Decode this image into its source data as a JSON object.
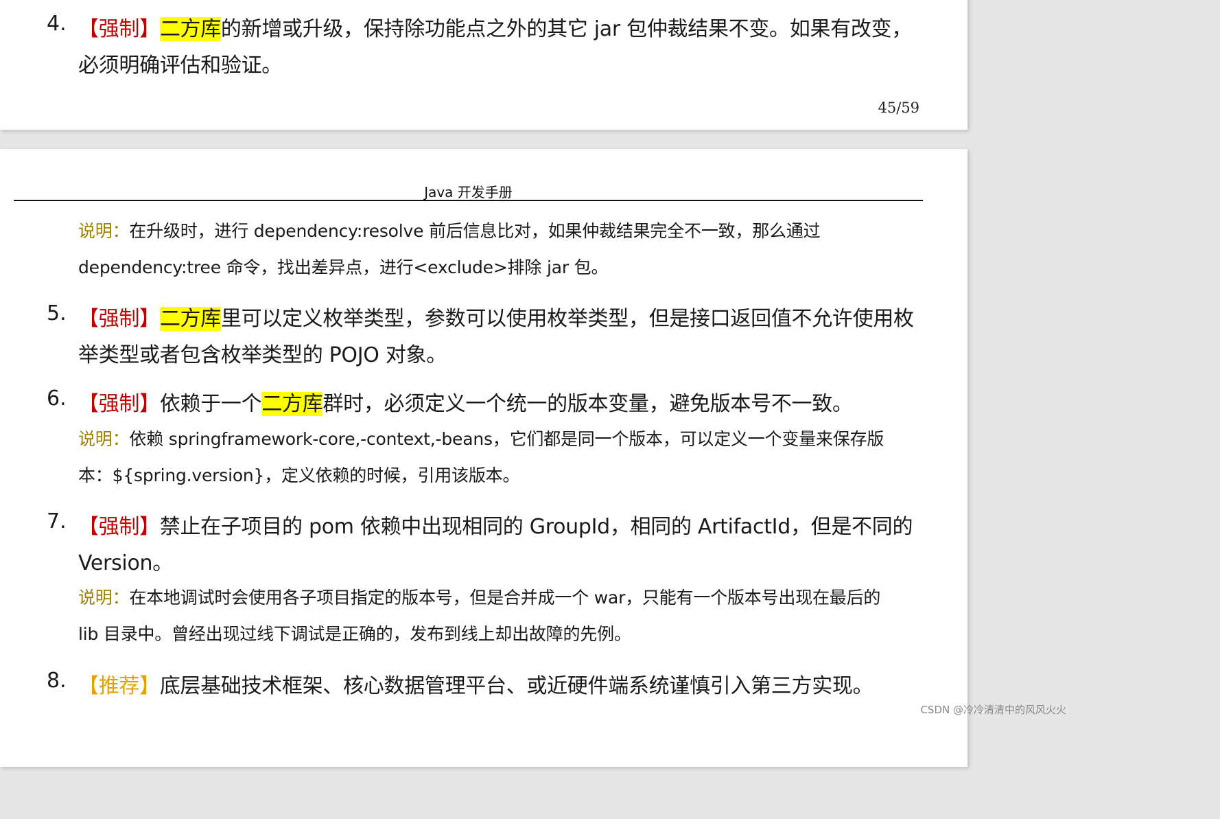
{
  "page1": {
    "item4": {
      "number": "4.",
      "tag": "【强制】",
      "highlight": "二方库",
      "line1_rest": "的新增或升级，保持除功能点之外的其它 jar 包仲裁结果不变。如果有改变，",
      "line2": "必须明确评估和验证。"
    },
    "page_number": "45/59"
  },
  "page2": {
    "header_title": "Java 开发手册",
    "note4": {
      "label": "说明：",
      "line1_rest": "在升级时，进行 dependency:resolve 前后信息比对，如果仲裁结果完全不一致，那么通过",
      "line2": "dependency:tree 命令，找出差异点，进行<exclude>排除 jar 包。"
    },
    "item5": {
      "number": "5.",
      "tag": "【强制】",
      "highlight": "二方库",
      "line1_rest": "里可以定义枚举类型，参数可以使用枚举类型，但是接口返回值不允许使用枚",
      "line2": "举类型或者包含枚举类型的 POJO 对象。"
    },
    "item6": {
      "number": "6.",
      "tag": "【强制】",
      "line1_pre": "依赖于一个",
      "highlight": "二方库",
      "line1_post": "群时，必须定义一个统一的版本变量，避免版本号不一致。",
      "note_label": "说明：",
      "note_line1_rest": "依赖 springframework-core,-context,-beans，它们都是同一个版本，可以定义一个变量来保存版",
      "note_line2": "本：${spring.version}，定义依赖的时候，引用该版本。"
    },
    "item7": {
      "number": "7.",
      "tag": "【强制】",
      "line1_rest": "禁止在子项目的 pom 依赖中出现相同的 GroupId，相同的 ArtifactId，但是不同的",
      "line2": "Version。",
      "note_label": "说明：",
      "note_line1_rest": "在本地调试时会使用各子项目指定的版本号，但是合并成一个 war，只能有一个版本号出现在最后的",
      "note_line2": "lib 目录中。曾经出现过线下调试是正确的，发布到线上却出故障的先例。"
    },
    "item8": {
      "number": "8.",
      "tag": "【推荐】",
      "line1_rest": "底层基础技术框架、核心数据管理平台、或近硬件端系统谨慎引入第三方实现。"
    }
  },
  "watermark": "CSDN @冷冷清清中的风风火火"
}
